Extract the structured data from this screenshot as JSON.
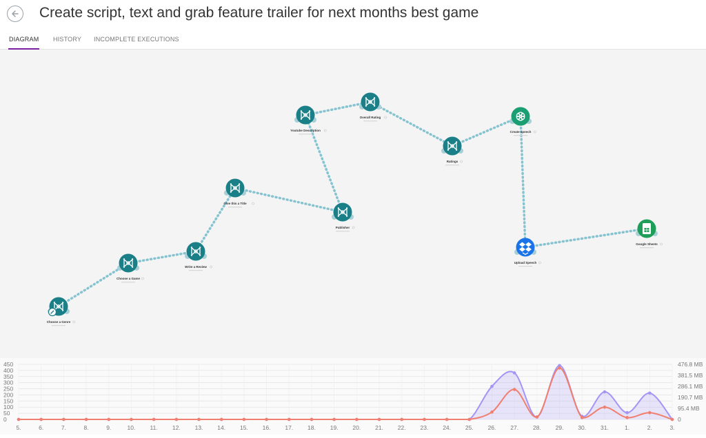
{
  "header": {
    "title": "Create script, text and grab feature trailer for next months best game",
    "back_icon": "arrow-left-icon"
  },
  "tabs": [
    {
      "label": "DIAGRAM",
      "active": true
    },
    {
      "label": "HISTORY",
      "active": false
    },
    {
      "label": "INCOMPLETE EXECUTIONS",
      "active": false
    }
  ],
  "scenario": {
    "nodes": [
      {
        "id": "n1",
        "label": "Choose a Genre",
        "icon": "openai-star-icon",
        "color": "#1a7f86"
      },
      {
        "id": "n2",
        "label": "Choose a Game",
        "icon": "openai-star-icon",
        "color": "#1a7f86"
      },
      {
        "id": "n3",
        "label": "Write a Review",
        "icon": "openai-star-icon",
        "color": "#1a7f86"
      },
      {
        "id": "n4",
        "label": "Give this a Title",
        "icon": "openai-star-icon",
        "color": "#1a7f86"
      },
      {
        "id": "n5",
        "label": "Publisher",
        "icon": "openai-star-icon",
        "color": "#1a7f86"
      },
      {
        "id": "n6",
        "label": "Youtube Description",
        "icon": "openai-star-icon",
        "color": "#1a7f86"
      },
      {
        "id": "n7",
        "label": "Overall Rating",
        "icon": "openai-star-icon",
        "color": "#1a7f86"
      },
      {
        "id": "n8",
        "label": "Ratings",
        "icon": "openai-star-icon",
        "color": "#1a7f86"
      },
      {
        "id": "n9",
        "label": "Create speech",
        "icon": "openai-logo-icon",
        "color": "#1a9e72"
      },
      {
        "id": "n10",
        "label": "Upload Speech",
        "icon": "dropbox-icon",
        "color": "#1a73e8"
      },
      {
        "id": "n11",
        "label": "Google Sheets",
        "icon": "google-sheets-icon",
        "color": "#1e9e58"
      }
    ],
    "edges": [
      [
        "n1",
        "n2"
      ],
      [
        "n2",
        "n3"
      ],
      [
        "n3",
        "n4"
      ],
      [
        "n4",
        "n5"
      ],
      [
        "n5",
        "n6"
      ],
      [
        "n6",
        "n7"
      ],
      [
        "n7",
        "n8"
      ],
      [
        "n8",
        "n9"
      ],
      [
        "n9",
        "n10"
      ],
      [
        "n10",
        "n11"
      ]
    ]
  },
  "chart_data": {
    "type": "area",
    "x": [
      "5.",
      "6.",
      "7.",
      "8.",
      "9.",
      "10.",
      "11.",
      "12.",
      "13.",
      "14.",
      "15.",
      "16.",
      "17.",
      "18.",
      "19.",
      "20.",
      "21.",
      "22.",
      "23.",
      "24.",
      "25.",
      "26.",
      "27.",
      "28.",
      "29.",
      "30.",
      "31.",
      "1.",
      "2.",
      "3."
    ],
    "series": [
      {
        "axis": "left",
        "color": "#f07f6f",
        "values": [
          0,
          0,
          0,
          0,
          0,
          0,
          0,
          0,
          0,
          0,
          0,
          0,
          0,
          0,
          0,
          0,
          0,
          0,
          0,
          0,
          0,
          60,
          245,
          20,
          420,
          15,
          100,
          15,
          55,
          0
        ]
      },
      {
        "axis": "right",
        "color": "#a495f5",
        "values": [
          0,
          0,
          0,
          0,
          0,
          0,
          0,
          0,
          0,
          0,
          0,
          0,
          0,
          0,
          0,
          0,
          0,
          0,
          0,
          0,
          0,
          270,
          380,
          20,
          440,
          25,
          225,
          55,
          215,
          0
        ]
      }
    ],
    "yticks_left": [
      "450",
      "400",
      "350",
      "300",
      "250",
      "200",
      "150",
      "100",
      "50",
      "0"
    ],
    "ylim_left": [
      0,
      450
    ],
    "yticks_right": [
      "476.8 MB",
      "381.5 MB",
      "286.1 MB",
      "190.7 MB",
      "95.4 MB",
      "0"
    ],
    "grid": true
  }
}
